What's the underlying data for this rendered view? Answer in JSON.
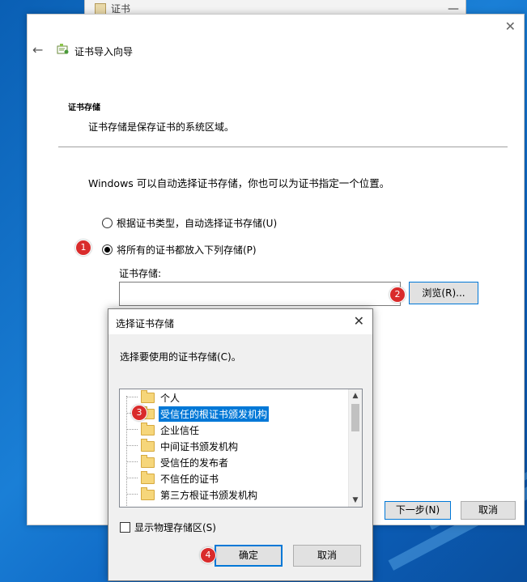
{
  "back_window": {
    "title": "证书",
    "minimize_glyph": "—"
  },
  "wizard": {
    "close_glyph": "✕",
    "back_glyph": "←",
    "title": "证书导入向导",
    "section_title": "证书存储",
    "section_desc": "证书存储是保存证书的系统区域。",
    "intro": "Windows 可以自动选择证书存储，你也可以为证书指定一个位置。",
    "radio_auto": {
      "label": "根据证书类型，自动选择证书存储(U)",
      "checked": false
    },
    "radio_manual": {
      "label": "将所有的证书都放入下列存储(P)",
      "checked": true
    },
    "store_label": "证书存储:",
    "store_value": "",
    "browse_label": "浏览(R)...",
    "next_label": "下一步(N)",
    "cancel_label": "取消"
  },
  "dialog": {
    "title": "选择证书存储",
    "close_glyph": "✕",
    "prompt": "选择要使用的证书存储(C)。",
    "stores": [
      {
        "label": "个人",
        "selected": false
      },
      {
        "label": "受信任的根证书颁发机构",
        "selected": true
      },
      {
        "label": "企业信任",
        "selected": false
      },
      {
        "label": "中间证书颁发机构",
        "selected": false
      },
      {
        "label": "受信任的发布者",
        "selected": false
      },
      {
        "label": "不信任的证书",
        "selected": false
      },
      {
        "label": "第三方根证书颁发机构",
        "selected": false
      }
    ],
    "scroll_up_glyph": "▲",
    "scroll_down_glyph": "▼",
    "show_physical_label": "显示物理存储区(S)",
    "show_physical_checked": false,
    "ok_label": "确定",
    "cancel_label": "取消"
  },
  "badges": [
    "1",
    "2",
    "3",
    "4"
  ],
  "icons": {
    "back": "back-arrow-icon",
    "wizard": "certificate-wizard-icon",
    "folder": "folder-icon"
  },
  "colors": {
    "accent": "#0078d7",
    "badge": "#d92b2b",
    "desktop": "#0c63c1"
  }
}
